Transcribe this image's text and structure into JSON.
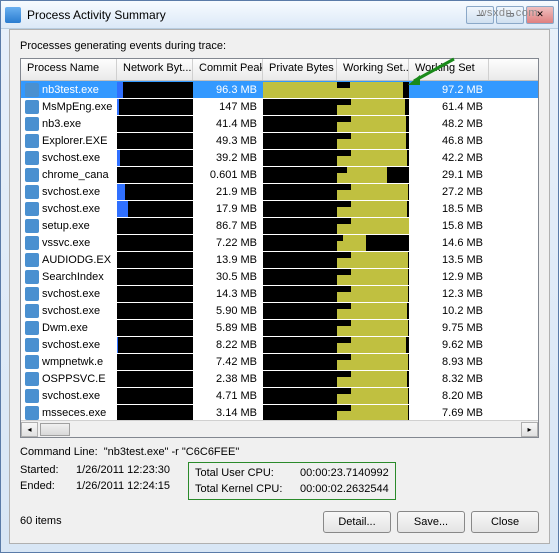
{
  "window": {
    "title": "Process Activity Summary"
  },
  "label": "Processes generating events during trace:",
  "columns": [
    "Process Name",
    "Network Byt...",
    "Commit Peak",
    "Private Bytes",
    "Working Set...",
    "Working Set"
  ],
  "rows": [
    {
      "name": "nb3test.exe",
      "commit": "96.3 MB",
      "ws": "97.2 MB",
      "sel": true,
      "net": 8,
      "wsg": 92,
      "cp": 100
    },
    {
      "name": "MsMpEng.exe",
      "commit": "147 MB",
      "ws": "61.4 MB",
      "net": 2,
      "wsg": 95,
      "cp": 0
    },
    {
      "name": "nb3.exe",
      "commit": "41.4 MB",
      "ws": "48.2 MB",
      "net": 0,
      "wsg": 96,
      "cp": 0
    },
    {
      "name": "Explorer.EXE",
      "commit": "49.3 MB",
      "ws": "46.8 MB",
      "net": 0,
      "wsg": 96,
      "cp": 0
    },
    {
      "name": "svchost.exe",
      "commit": "39.2 MB",
      "ws": "42.2 MB",
      "net": 4,
      "wsg": 97,
      "cp": 0
    },
    {
      "name": "chrome_cana",
      "commit": "0.601 MB",
      "ws": "29.1 MB",
      "net": 0,
      "wsg": 70,
      "cp": 0
    },
    {
      "name": "svchost.exe",
      "commit": "21.9 MB",
      "ws": "27.2 MB",
      "net": 10,
      "wsg": 98,
      "cp": 0
    },
    {
      "name": "svchost.exe",
      "commit": "17.9 MB",
      "ws": "18.5 MB",
      "net": 15,
      "wsg": 97,
      "cp": 0
    },
    {
      "name": "setup.exe",
      "commit": "86.7 MB",
      "ws": "15.8 MB",
      "net": 0,
      "wsg": 100,
      "cp": 0
    },
    {
      "name": "vssvc.exe",
      "commit": "7.22 MB",
      "ws": "14.6 MB",
      "net": 0,
      "wsg": 40,
      "cp": 0
    },
    {
      "name": "AUDIODG.EX",
      "commit": "13.9 MB",
      "ws": "13.5 MB",
      "net": 0,
      "wsg": 98,
      "cp": 0
    },
    {
      "name": "SearchIndex",
      "commit": "30.5 MB",
      "ws": "12.9 MB",
      "net": 0,
      "wsg": 98,
      "cp": 0
    },
    {
      "name": "svchost.exe",
      "commit": "14.3 MB",
      "ws": "12.3 MB",
      "net": 0,
      "wsg": 98,
      "cp": 0
    },
    {
      "name": "svchost.exe",
      "commit": "5.90 MB",
      "ws": "10.2 MB",
      "net": 0,
      "wsg": 97,
      "cp": 0
    },
    {
      "name": "Dwm.exe",
      "commit": "5.89 MB",
      "ws": "9.75 MB",
      "net": 0,
      "wsg": 98,
      "cp": 0
    },
    {
      "name": "svchost.exe",
      "commit": "8.22 MB",
      "ws": "9.62 MB",
      "net": 1,
      "wsg": 96,
      "cp": 0
    },
    {
      "name": "wmpnetwk.e",
      "commit": "7.42 MB",
      "ws": "8.93 MB",
      "net": 0,
      "wsg": 98,
      "cp": 0
    },
    {
      "name": "OSPPSVC.E",
      "commit": "2.38 MB",
      "ws": "8.32 MB",
      "net": 0,
      "wsg": 97,
      "cp": 0
    },
    {
      "name": "svchost.exe",
      "commit": "4.71 MB",
      "ws": "8.20 MB",
      "net": 0,
      "wsg": 98,
      "cp": 0
    },
    {
      "name": "msseces.exe",
      "commit": "3.14 MB",
      "ws": "7.69 MB",
      "net": 0,
      "wsg": 98,
      "cp": 0
    }
  ],
  "cmd": {
    "label": "Command Line:",
    "value": "\"nb3test.exe\" -r \"C6C6FEE\""
  },
  "started": {
    "label": "Started:",
    "value": "1/26/2011 12:23:30"
  },
  "ended": {
    "label": "Ended:",
    "value": "1/26/2011 12:24:15"
  },
  "user_cpu": {
    "label": "Total User CPU:",
    "value": "00:00:23.7140992"
  },
  "kern_cpu": {
    "label": "Total Kernel CPU:",
    "value": "00:00:02.2632544"
  },
  "items": "60 items",
  "buttons": {
    "detail": "Detail...",
    "save": "Save...",
    "close": "Close"
  },
  "watermark": "wsxdn.com"
}
